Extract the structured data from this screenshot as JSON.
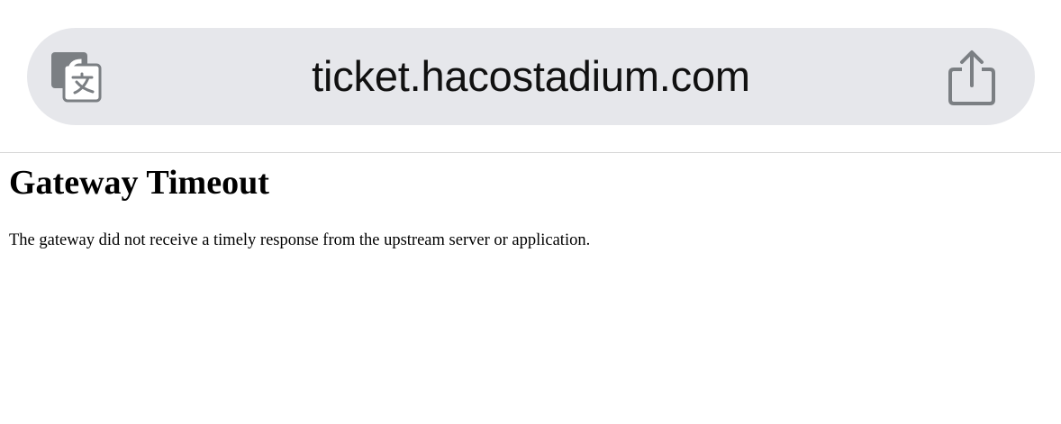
{
  "browser": {
    "url": "ticket.hacostadium.com",
    "left_icon": "translate-icon",
    "right_icon": "share-icon",
    "colors": {
      "address_bar_bg": "#e6e7eb",
      "icon_gray": "#7b7f83",
      "divider": "#d6d6d6"
    }
  },
  "page": {
    "title": "Gateway Timeout",
    "message": "The gateway did not receive a timely response from the upstream server or application."
  }
}
